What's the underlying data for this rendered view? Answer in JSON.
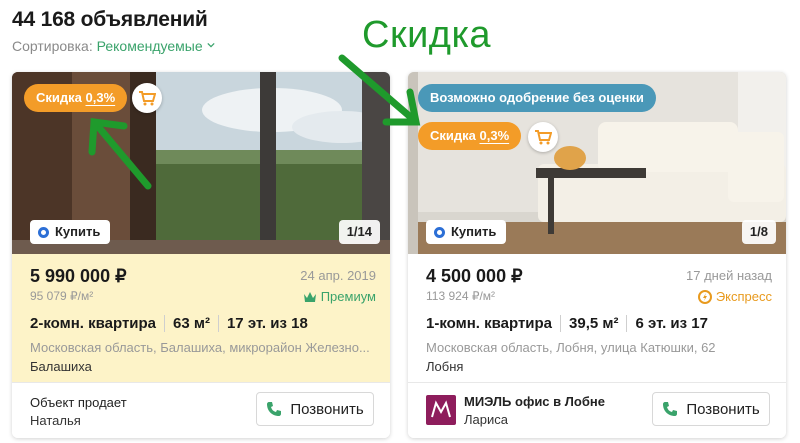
{
  "header": {
    "listing_count": "44 168 объявлений",
    "sort_label": "Сортировка:",
    "sort_value": "Рекомендуемые"
  },
  "annotation": {
    "title": "Скидка",
    "color": "#1f9a2c"
  },
  "listings": [
    {
      "discount_prefix": "Скидка ",
      "discount_value": "0,3%",
      "buy_label": "Купить",
      "photo_counter": "1/14",
      "price": "5 990 000 ₽",
      "price_per_m2": "95 079 ₽/м²",
      "date": "24 апр. 2019",
      "tag": "Премиум",
      "params": [
        "2-комн. квартира",
        "63 м²",
        "17 эт. из 18"
      ],
      "address": "Московская область, Балашиха, микрорайон Железно...",
      "city": "Балашиха",
      "seller_type": "Объект продает",
      "seller_name": "Наталья",
      "call_label": "Позвонить",
      "background": "#fdf3c8"
    },
    {
      "approval_badge": "Возможно одобрение без оценки",
      "discount_prefix": "Скидка ",
      "discount_value": "0,3%",
      "buy_label": "Купить",
      "photo_counter": "1/8",
      "price": "4 500 000 ₽",
      "price_per_m2": "113 924 ₽/м²",
      "date": "17 дней назад",
      "tag": "Экспресс",
      "params": [
        "1-комн. квартира",
        "39,5 м²",
        "6 эт. из 17"
      ],
      "address": "Московская область, Лобня, улица Катюшки, 62",
      "city": "Лобня",
      "agency_name": "МИЭЛЬ офис в Лобне",
      "agency_agent": "Лариса",
      "call_label": "Позвонить",
      "background": "#ffffff"
    }
  ],
  "colors": {
    "accent_green": "#3aa36b",
    "discount_orange": "#f39c28",
    "approval_blue": "#4a98b8",
    "express_orange": "#e89a1e"
  }
}
